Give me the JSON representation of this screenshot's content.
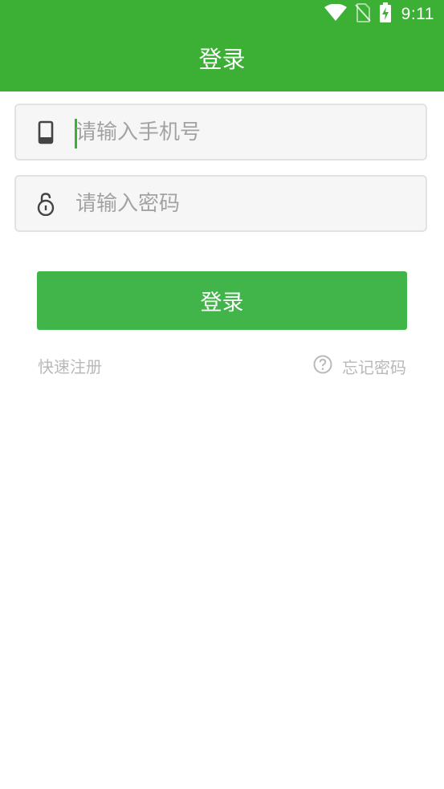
{
  "status_bar": {
    "time": "9:11",
    "icons": [
      "wifi-icon",
      "no-sim-icon",
      "battery-charging-icon"
    ]
  },
  "header": {
    "title": "登录"
  },
  "form": {
    "phone": {
      "icon": "phone-icon",
      "placeholder": "请输入手机号",
      "value": ""
    },
    "password": {
      "icon": "lock-icon",
      "placeholder": "请输入密码",
      "value": ""
    },
    "login_label": "登录"
  },
  "links": {
    "register": "快速注册",
    "forgot_icon": "help-circle-icon",
    "forgot": "忘记密码"
  },
  "colors": {
    "primary": "#3cb034",
    "button": "#41b54a",
    "field_bg": "#f6f6f6",
    "field_border": "#e2e2e2",
    "placeholder": "#a3a3a3",
    "link": "#b9b9b9"
  }
}
